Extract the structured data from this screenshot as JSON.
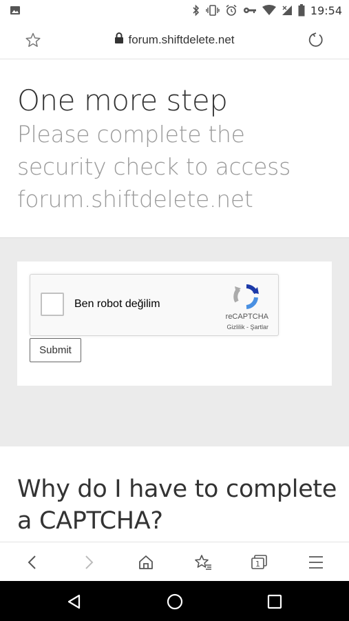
{
  "status_bar": {
    "time": "19:54",
    "icons": [
      "image-icon",
      "bluetooth-icon",
      "vibrate-icon",
      "alarm-icon",
      "key-icon",
      "wifi-icon",
      "signal-icon",
      "battery-icon"
    ]
  },
  "url_bar": {
    "url": "forum.shiftdelete.net"
  },
  "header": {
    "title": "One more step",
    "subtitle": "Please complete the security check to access forum.shiftdelete.net"
  },
  "captcha": {
    "checkbox_label": "Ben robot değilim",
    "brand": "reCAPTCHA",
    "links": "Gizlilik - Şartlar",
    "submit_label": "Submit"
  },
  "why": {
    "title": "Why do I have to complete a CAPTCHA?"
  },
  "toolbar": {
    "items": [
      "back-icon",
      "forward-icon",
      "home-icon",
      "bookmarks-icon",
      "tabs-icon",
      "menu-icon"
    ],
    "tab_count": "1"
  },
  "nav_bar": {
    "items": [
      "nav-back-icon",
      "nav-home-icon",
      "nav-recents-icon"
    ]
  },
  "colors": {
    "text_dark": "#333333",
    "text_muted": "#9a9a9a",
    "band_gray": "#ebebeb",
    "recaptcha_blue": "#4a90e2"
  }
}
